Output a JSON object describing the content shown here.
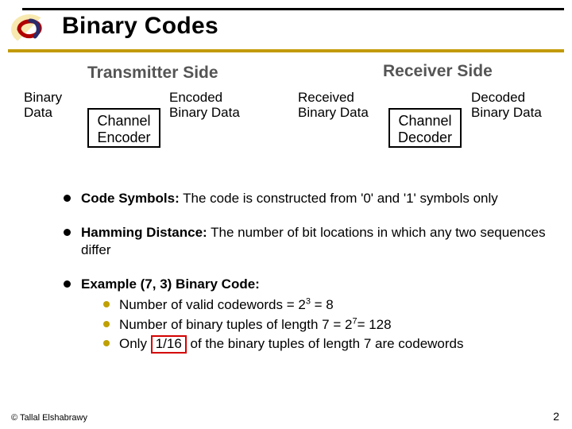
{
  "title": "Binary Codes",
  "sections": {
    "tx": "Transmitter Side",
    "rx": "Receiver Side"
  },
  "diagram": {
    "binary_data": "Binary\nData",
    "encoder_block": "Channel\nEncoder",
    "encoded": "Encoded\nBinary Data",
    "received": "Received\nBinary Data",
    "decoder_block": "Channel\nDecoder",
    "decoded": "Decoded\nBinary Data"
  },
  "bullets": {
    "b1_term": "Code Symbols:",
    "b1_rest": " The code is constructed from '0' and '1' symbols only",
    "b2_term": "Hamming Distance:",
    "b2_rest": " The number of bit locations in which any two sequences differ",
    "b3_term": "Example (7, 3) Binary Code:",
    "b3_sub1_a": "Number of valid codewords = 2",
    "b3_sub1_sup": "3",
    "b3_sub1_b": " = 8",
    "b3_sub2_a": "Number of binary tuples of length 7 = 2",
    "b3_sub2_sup": "7",
    "b3_sub2_b": "= 128",
    "b3_sub3_a": "Only ",
    "b3_sub3_hi": "1/16",
    "b3_sub3_b": " of the binary tuples of length 7 are codewords"
  },
  "footer": {
    "copyright": "© Tallal Elshabrawy",
    "page_number": "2"
  }
}
